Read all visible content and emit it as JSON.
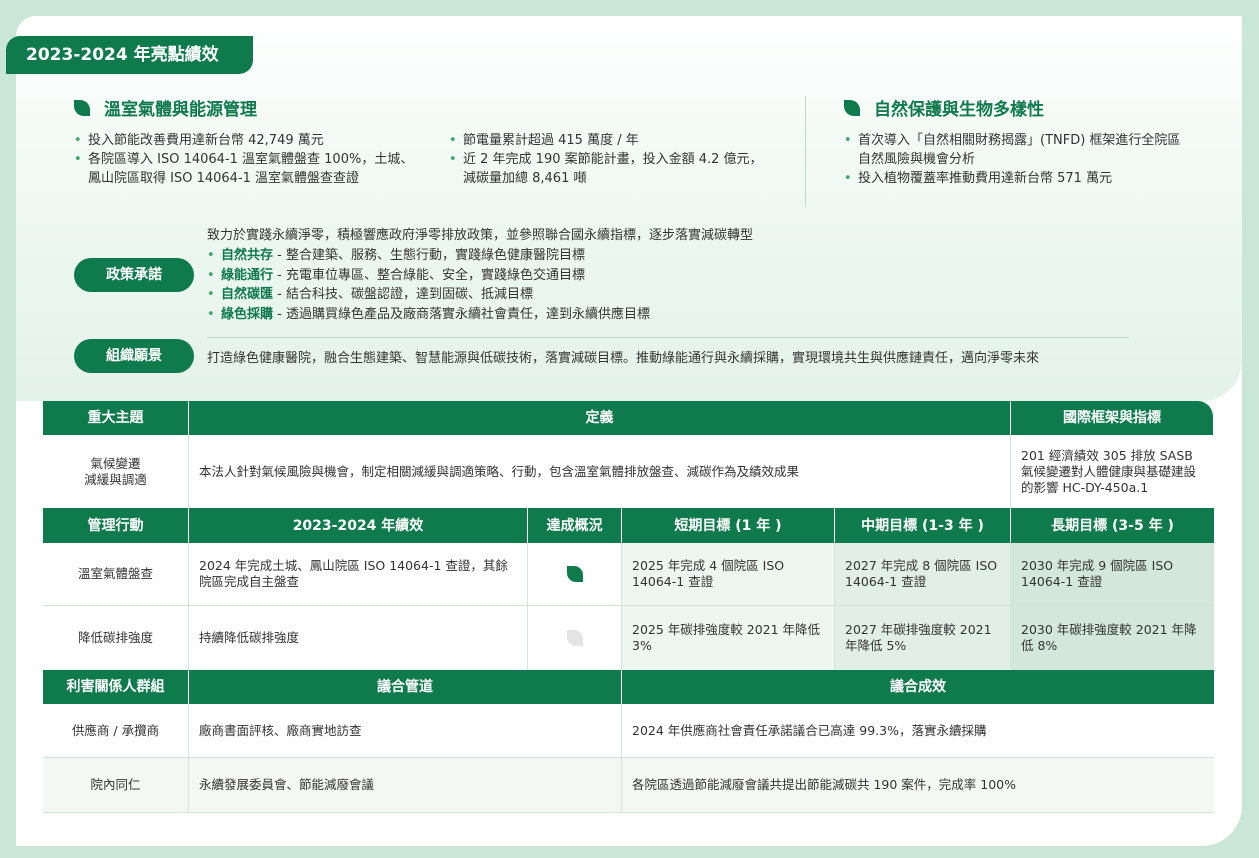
{
  "year_tag": "2023-2024 年亮點績效",
  "ghg": {
    "title": "溫室氣體與能源管理",
    "left_items": [
      "投入節能改善費用達新台幣 42,749 萬元",
      "各院區導入 ISO 14064-1 溫室氣體盤查 100%，土城、鳳山院區取得 ISO 14064-1 溫室氣體盤查查證"
    ],
    "right_items": [
      "節電量累計超過 415 萬度 / 年",
      "近 2 年完成 190 案節能計畫，投入金額 4.2 億元，減碳量加總 8,461 噸"
    ]
  },
  "nature": {
    "title": "自然保護與生物多樣性",
    "items": [
      "首次導入「自然相關財務揭露」(TNFD) 框架進行全院區自然風險與機會分析",
      "投入植物覆蓋率推動費用達新台幣 571 萬元"
    ]
  },
  "policy": {
    "label": "政策承諾",
    "intro": "致力於實踐永續淨零，積極響應政府淨零排放政策，並參照聯合國永續指標，逐步落實減碳轉型",
    "items": [
      {
        "keyword": "自然共存",
        "text": " - 整合建築、服務、生態行動，實踐綠色健康醫院目標"
      },
      {
        "keyword": "綠能通行",
        "text": " - 充電車位專區、整合綠能、安全，實踐綠色交通目標"
      },
      {
        "keyword": "自然碳匯",
        "text": " - 結合科技、碳盤認證，達到固碳、抵減目標"
      },
      {
        "keyword": "綠色採購",
        "text": " - 透過購買綠色產品及廠商落實永續社會責任，達到永續供應目標"
      }
    ]
  },
  "vision": {
    "label": "組織願景",
    "text": "打造綠色健康醫院，融合生態建築、智慧能源與低碳技術，落實減碳目標。推動綠能通行與永續採購，實現環境共生與供應鏈責任，邁向淨零未來"
  },
  "topic_table": {
    "headers": [
      "重大主題",
      "定義",
      "國際框架與指標"
    ],
    "topic": "氣候變遷\n減緩與調適",
    "definition": "本法人針對氣候風險與機會，制定相關減緩與調適策略、行動，包含溫室氣體排放盤查、減碳作為及績效成果",
    "framework": "201 經濟績效 305 排放 SASB 氣候變遷對人體健康與基礎建設的影響 HC-DY-450a.1"
  },
  "action_table": {
    "headers": [
      "管理行動",
      "2023-2024 年績效",
      "達成概況",
      "短期目標 (1 年 )",
      "中期目標 (1-3 年 )",
      "長期目標 (3-5 年 )"
    ],
    "rows": [
      {
        "action": "溫室氣體盤查",
        "performance": "2024 年完成土城、鳳山院區 ISO 14064-1 查證，其餘院區完成自主盤查",
        "status": "achieved",
        "short": "2025 年完成 4 個院區 ISO 14064-1 查證",
        "mid": "2027 年完成 8 個院區 ISO 14064-1 查證",
        "long": "2030 年完成 9 個院區 ISO 14064-1 查證"
      },
      {
        "action": "降低碳排強度",
        "performance": "持續降低碳排強度",
        "status": "in-progress",
        "short": "2025 年碳排強度較 2021 年降低 3%",
        "mid": "2027 年碳排強度較 2021 年降低 5%",
        "long": "2030 年碳排強度較 2021 年降低 8%"
      }
    ]
  },
  "stakeholder_table": {
    "headers": [
      "利害關係人群組",
      "議合管道",
      "議合成效"
    ],
    "rows": [
      {
        "group": "供應商 / 承攬商",
        "channel": "廠商書面評核、廠商實地訪查",
        "result": "2024 年供應商社會責任承諾議合已高達 99.3%，落實永續採購"
      },
      {
        "group": "院內同仁",
        "channel": "永續發展委員會、節能減廢會議",
        "result": "各院區透過節能減廢會議共提出節能減碳共 190 案件，完成率 100%"
      }
    ]
  },
  "colors": {
    "brand": "#0f7a4c",
    "accent": "#3aaa68",
    "background": "#c9e6d6"
  }
}
